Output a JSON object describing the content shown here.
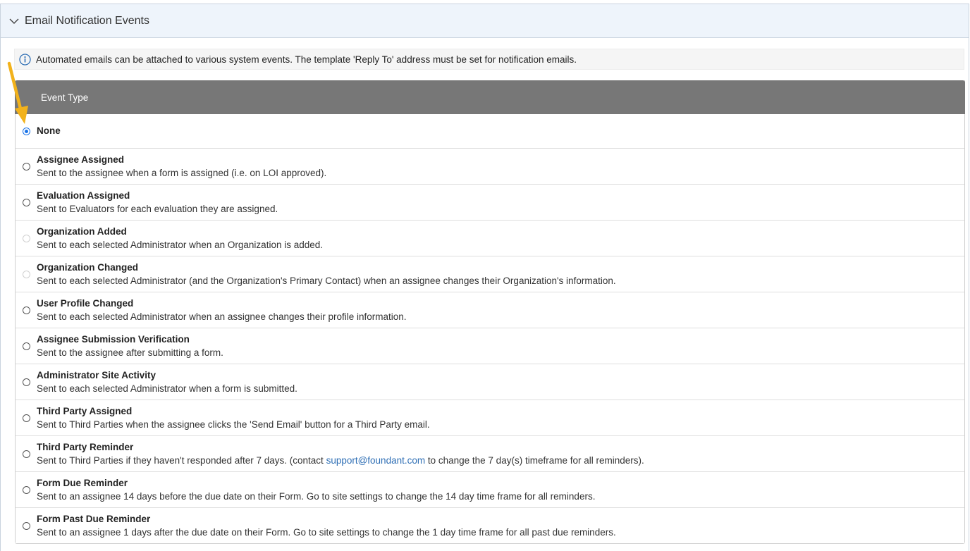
{
  "panel": {
    "title": "Email Notification Events"
  },
  "info": {
    "text": "Automated emails can be attached to various system events. The template 'Reply To' address must be set for notification emails."
  },
  "table": {
    "header": "Event Type",
    "rows": [
      {
        "title": "None",
        "desc": "",
        "state": "checked"
      },
      {
        "title": "Assignee Assigned",
        "desc": "Sent to the assignee when a form is assigned (i.e. on LOI approved).",
        "state": "normal"
      },
      {
        "title": "Evaluation Assigned",
        "desc": "Sent to Evaluators for each evaluation they are assigned.",
        "state": "normal"
      },
      {
        "title": "Organization Added",
        "desc": "Sent to each selected Administrator when an Organization is added.",
        "state": "disabled"
      },
      {
        "title": "Organization Changed",
        "desc": "Sent to each selected Administrator (and the Organization's Primary Contact) when an assignee changes their Organization's information.",
        "state": "disabled"
      },
      {
        "title": "User Profile Changed",
        "desc": "Sent to each selected Administrator when an assignee changes their profile information.",
        "state": "normal"
      },
      {
        "title": "Assignee Submission Verification",
        "desc": "Sent to the assignee after submitting a form.",
        "state": "normal"
      },
      {
        "title": "Administrator Site Activity",
        "desc": "Sent to each selected Administrator when a form is submitted.",
        "state": "normal"
      },
      {
        "title": "Third Party Assigned",
        "desc": "Sent to Third Parties when the assignee clicks the 'Send Email' button for a Third Party email.",
        "state": "normal"
      },
      {
        "title": "Third Party Reminder",
        "desc_before": "Sent to Third Parties if they haven't responded after 7 days. (contact ",
        "desc_link": "support@foundant.com",
        "desc_after": " to change the 7 day(s) timeframe for all reminders).",
        "state": "normal"
      },
      {
        "title": "Form Due Reminder",
        "desc": "Sent to an assignee 14 days before the due date on their Form. Go to site settings to change the 14 day time frame for all reminders.",
        "state": "normal"
      },
      {
        "title": "Form Past Due Reminder",
        "desc": "Sent to an assignee 1 days after the due date on their Form. Go to site settings to change the 1 day time frame for all past due reminders.",
        "state": "normal"
      }
    ]
  },
  "colors": {
    "accent": "#1a73e8",
    "header_bg": "#777777",
    "arrow": "#f2b21b",
    "link": "#2f6fb5"
  },
  "icons": {
    "collapse": "chevron-down-icon",
    "info": "info-icon",
    "annotation": "arrow-annotation-icon"
  }
}
